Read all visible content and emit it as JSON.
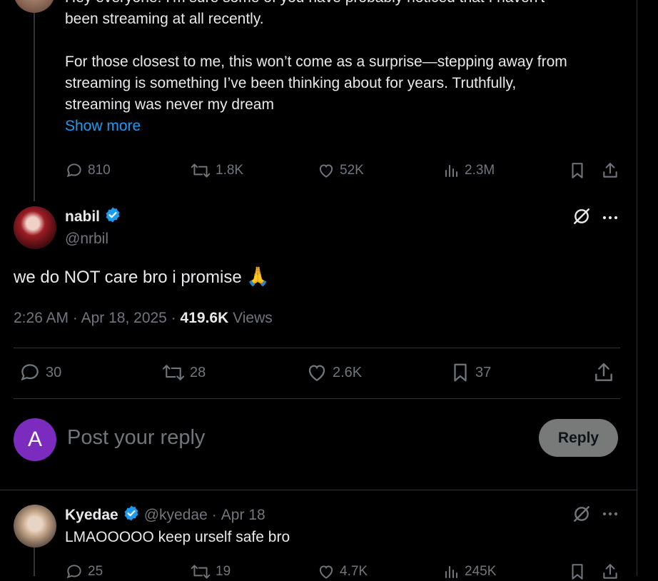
{
  "top_post": {
    "text_line0": "Hey everyone! I'm sure some of you have probably noticed that I haven't",
    "text_line1": "been streaming at all recently.",
    "text_line2": "For those closest to me, this won’t come as a surprise—stepping away from",
    "text_line3": "streaming is something I’ve been thinking about for years. Truthfully,",
    "text_line4": "streaming was never my dream",
    "show_more": "Show more",
    "replies": "810",
    "reposts": "1.8K",
    "likes": "52K",
    "views": "2.3M"
  },
  "main_post": {
    "name": "nabil",
    "handle": "@nrbil",
    "text": "we do NOT care bro i promise",
    "emoji": "🙏",
    "time": "2:26 AM",
    "sep1": "·",
    "date": "Apr 18, 2025",
    "sep2": "·",
    "views_count": "419.6K",
    "views_label": "Views",
    "replies": "30",
    "reposts": "28",
    "likes": "2.6K",
    "bookmarks": "37"
  },
  "reply_box": {
    "avatar_letter": "A",
    "placeholder": "Post your reply",
    "button": "Reply"
  },
  "reply_post": {
    "name": "Kyedae",
    "handle": "@kyedae",
    "sep": "·",
    "date": "Apr 18",
    "text": "LMAOOOOO keep urself safe bro",
    "replies": "25",
    "reposts": "19",
    "likes": "4.7K",
    "views": "245K"
  },
  "colors": {
    "background": "#000000",
    "text": "#e7e9ea",
    "muted": "#71767b",
    "link": "#1d9bf0",
    "verified": "#1d9bf0",
    "reply_avatar": "#7b2cbf",
    "reply_button": "#787a7a"
  }
}
